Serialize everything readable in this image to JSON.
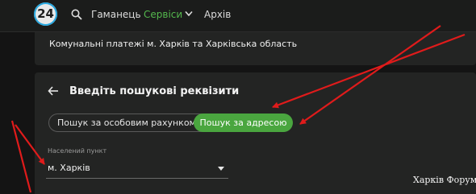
{
  "header": {
    "logo_text": "24",
    "nav": {
      "item1": "Гаманець",
      "item2": "Сервіси",
      "item3": "Архів"
    }
  },
  "card1": {
    "title": "Комунальні платежі м. Харків та Харківська область"
  },
  "search": {
    "title": "Введіть пошукові реквізити",
    "options": {
      "account": "Пошук за особовим рахунком",
      "address": "Пошук за адресою"
    },
    "selected_option": "address",
    "field": {
      "label": "Населений пункт",
      "value": "м. Харків"
    }
  },
  "watermark": "Харків Форум",
  "colors": {
    "accent_green": "#4aa63f",
    "nav_active": "#54b84d",
    "annotation_red": "#e01b1b"
  },
  "icons": {
    "search": "search-icon",
    "chevron": "chevron-down-icon",
    "back": "arrow-left-icon",
    "dropdown": "caret-down-icon"
  }
}
